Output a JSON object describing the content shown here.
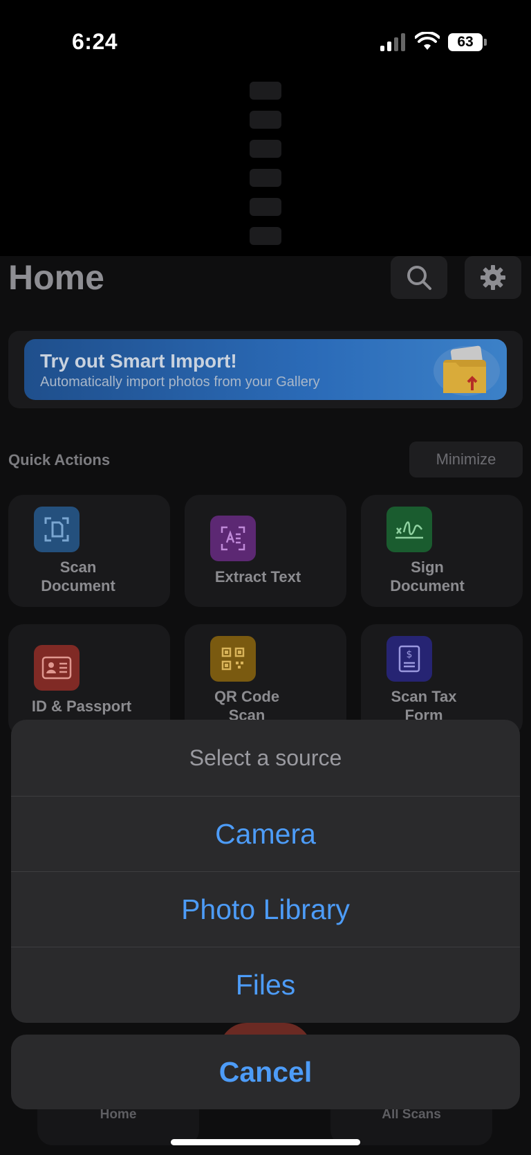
{
  "status_bar": {
    "time": "6:24",
    "battery": "63"
  },
  "header": {
    "title": "Home"
  },
  "banner": {
    "title": "Try out Smart Import!",
    "subtitle": "Automatically import photos from your Gallery"
  },
  "quick_actions": {
    "label": "Quick Actions",
    "minimize_label": "Minimize",
    "items": [
      {
        "label_line1": "Scan",
        "label_line2": "Document",
        "icon": "scan-document-icon",
        "color": "#2a5b8f"
      },
      {
        "label_line1": "Extract Text",
        "label_line2": "",
        "icon": "extract-text-icon",
        "color": "#6a2e86"
      },
      {
        "label_line1": "Sign",
        "label_line2": "Document",
        "icon": "signature-icon",
        "color": "#1d6a35"
      },
      {
        "label_line1": "ID & Passport",
        "label_line2": "",
        "icon": "id-card-icon",
        "color": "#93302b"
      },
      {
        "label_line1": "QR Code",
        "label_line2": "Scan",
        "icon": "qr-code-icon",
        "color": "#8e6a10"
      },
      {
        "label_line1": "Scan Tax",
        "label_line2": "Form",
        "icon": "tax-form-icon",
        "color": "#2c2b82"
      }
    ]
  },
  "tab_bar": {
    "home_label": "Home",
    "all_scans_label": "All Scans"
  },
  "action_sheet": {
    "title": "Select a source",
    "options": [
      "Camera",
      "Photo Library",
      "Files"
    ],
    "cancel_label": "Cancel"
  },
  "colors": {
    "accent": "#4d9cf8",
    "sheet_bg": "#2a2a2c"
  }
}
